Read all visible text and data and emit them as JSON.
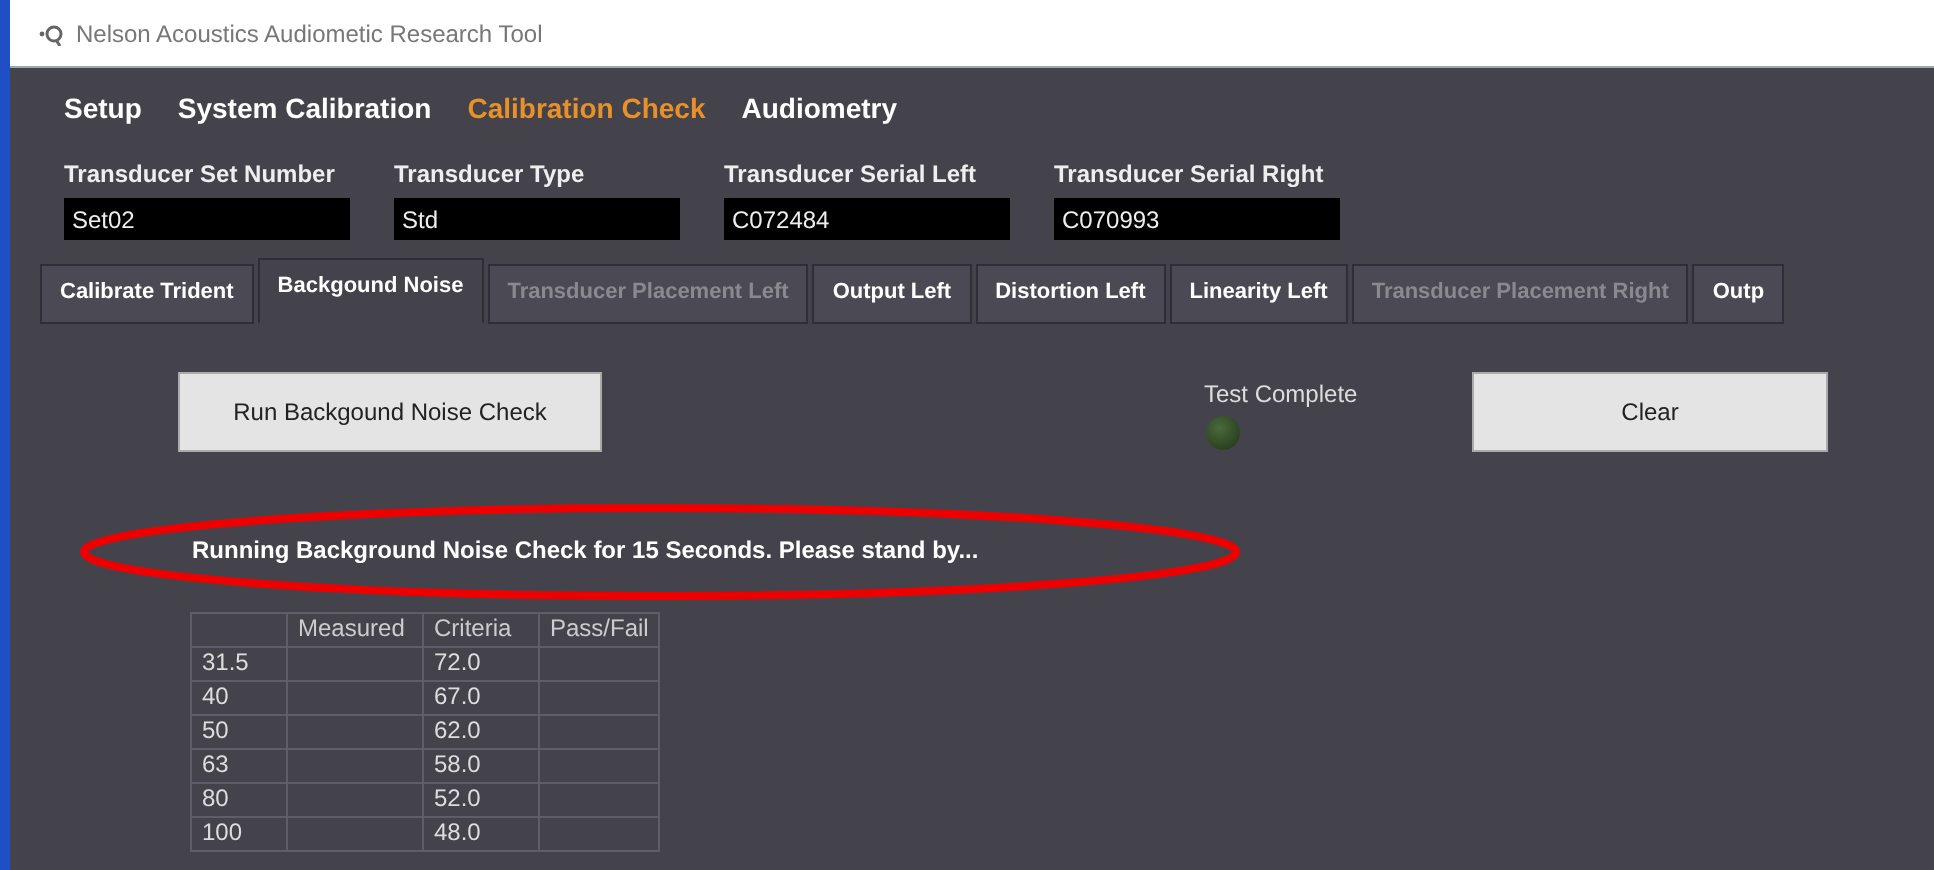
{
  "window": {
    "title": "Nelson Acoustics Audiometic Research Tool"
  },
  "menu": [
    {
      "label": "Setup",
      "selected": false
    },
    {
      "label": "System Calibration",
      "selected": false
    },
    {
      "label": "Calibration Check",
      "selected": true
    },
    {
      "label": "Audiometry",
      "selected": false
    }
  ],
  "fields": [
    {
      "label": "Transducer Set Number",
      "value": "Set02"
    },
    {
      "label": "Transducer Type",
      "value": "Std"
    },
    {
      "label": "Transducer Serial Left",
      "value": "C072484"
    },
    {
      "label": "Transducer Serial Right",
      "value": "C070993"
    }
  ],
  "tabs": [
    {
      "label": "Calibrate Trident",
      "selected": false,
      "disabled": false
    },
    {
      "label": "Backgound Noise",
      "selected": true,
      "disabled": false
    },
    {
      "label": "Transducer Placement Left",
      "selected": false,
      "disabled": true
    },
    {
      "label": "Output Left",
      "selected": false,
      "disabled": false
    },
    {
      "label": "Distortion Left",
      "selected": false,
      "disabled": false
    },
    {
      "label": "Linearity Left",
      "selected": false,
      "disabled": false
    },
    {
      "label": "Transducer Placement Right",
      "selected": false,
      "disabled": true
    },
    {
      "label": "Outp",
      "selected": false,
      "disabled": false
    }
  ],
  "run_button": "Run Backgound Noise Check",
  "indicator": {
    "label": "Test Complete",
    "on": false
  },
  "clear_button": "Clear",
  "message": "Running Background Noise Check for 15 Seconds. Please stand by...",
  "table": {
    "columns": [
      "Measured",
      "Criteria",
      "Pass/Fail"
    ],
    "rows": [
      [
        "31.5",
        "",
        "72.0",
        ""
      ],
      [
        "40",
        "",
        "67.0",
        ""
      ],
      [
        "50",
        "",
        "62.0",
        ""
      ],
      [
        "63",
        "",
        "58.0",
        ""
      ],
      [
        "80",
        "",
        "52.0",
        ""
      ],
      [
        "100",
        "",
        "48.0",
        ""
      ]
    ]
  }
}
